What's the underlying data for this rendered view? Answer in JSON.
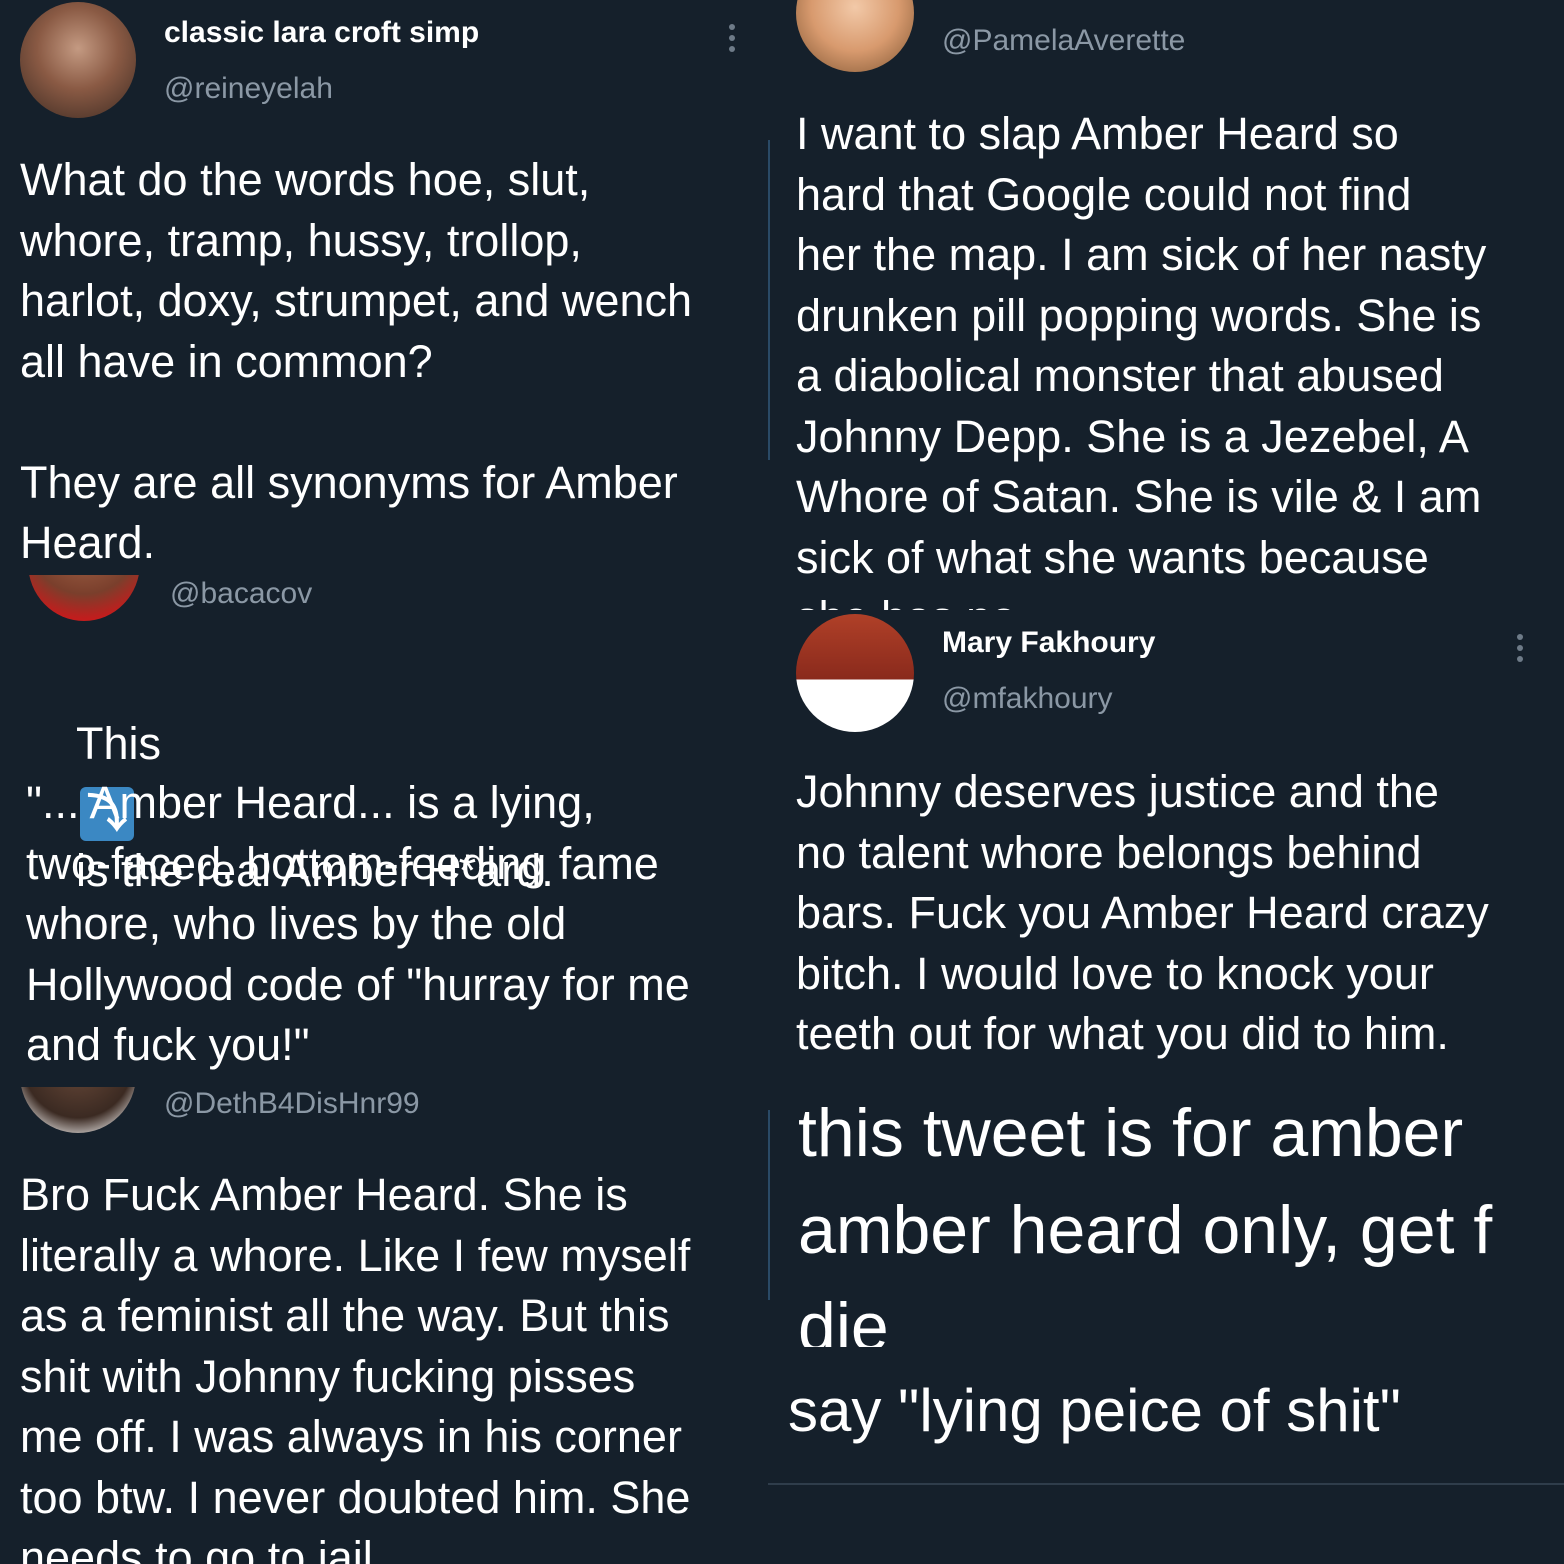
{
  "tweet_lara": {
    "name": "classic lara croft simp",
    "handle": "@reineyelah",
    "text": "What do the words hoe, slut,\nwhore, tramp, hussy, trollop,\nharlot, doxy, strumpet, and wench\nall have in common?\n\nThey are all synonyms for Amber\nHeard."
  },
  "tweet_bacacov": {
    "handle": "@bacacov",
    "text_before": "This",
    "emoji": "⤵",
    "text_after": "is the real Amber H*ard.",
    "quote": "\"... Amber Heard... is a lying,\ntwo-faced, bottom-feeding fame\nwhore, who lives by the old\nHollywood code of \"hurray for me\nand fuck you!\""
  },
  "tweet_deth": {
    "handle": "@DethB4DisHnr99",
    "text": "Bro Fuck Amber Heard. She is\nliterally a whore. Like I few myself\nas a feminist all the way. But this\nshit with Johnny fucking pisses\nme off. I was always in his corner\ntoo btw. I never doubted him. She\nneeds to go to jail"
  },
  "tweet_pamela": {
    "handle": "@PamelaAverette",
    "text": "I want to slap Amber Heard so\nhard that Google could not find\nher the map. I am sick of her nasty\ndrunken pill popping words. She is\na diabolical monster that abused\nJohnny Depp. She is a Jezebel, A\nWhore of Satan. She is vile & I am\nsick of what she wants because\nshe has no..."
  },
  "tweet_mary": {
    "name": "Mary Fakhoury",
    "handle": "@mfakhoury",
    "text": "Johnny deserves justice and the\nno talent whore belongs behind\nbars. Fuck you Amber Heard crazy\nbitch. I would love to knock your\nteeth out for what you did to him."
  },
  "tweet_amber_only": {
    "text": "this tweet is for amber\namber heard only, get f\ndie"
  },
  "tweet_lying": {
    "text": "say \"lying peice of shit\""
  },
  "colors": {
    "background": "#15202b",
    "text": "#ffffff",
    "handle": "#8b98a5",
    "emoji_blue": "#3b88c3"
  }
}
